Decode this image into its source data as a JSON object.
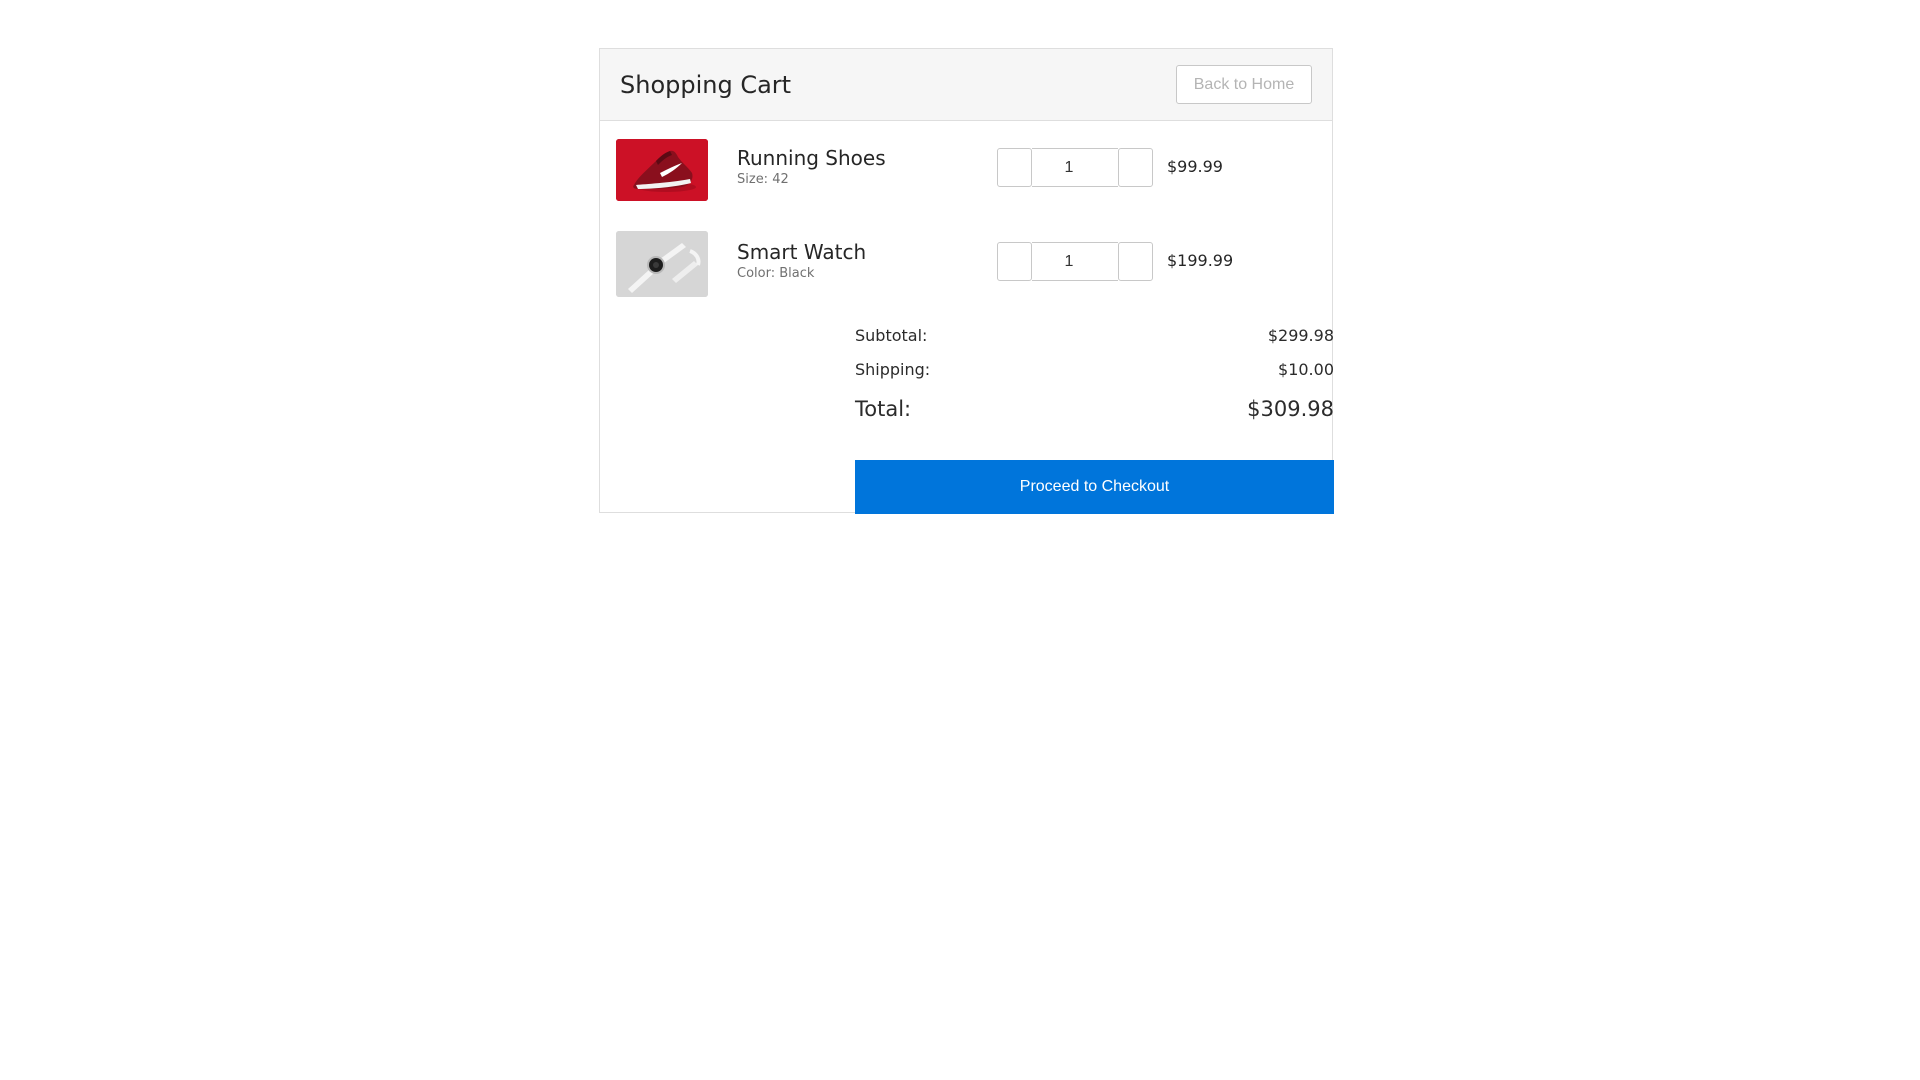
{
  "header": {
    "title": "Shopping Cart",
    "back_label": "Back to Home"
  },
  "items": [
    {
      "name": "Running Shoes",
      "meta": "Size: 42",
      "quantity": "1",
      "price": "$99.99",
      "image": "red-running-shoe-photo"
    },
    {
      "name": "Smart Watch",
      "meta": "Color: Black",
      "quantity": "1",
      "price": "$199.99",
      "image": "white-smart-watch-photo"
    }
  ],
  "summary": {
    "subtotal_label": "Subtotal:",
    "subtotal_value": "$299.98",
    "shipping_label": "Shipping:",
    "shipping_value": "$10.00",
    "total_label": "Total:",
    "total_value": "$309.98"
  },
  "checkout": {
    "label": "Proceed to Checkout"
  },
  "colors": {
    "accent": "#0075db",
    "header_bg": "#f6f6f6",
    "border": "#dedede"
  }
}
